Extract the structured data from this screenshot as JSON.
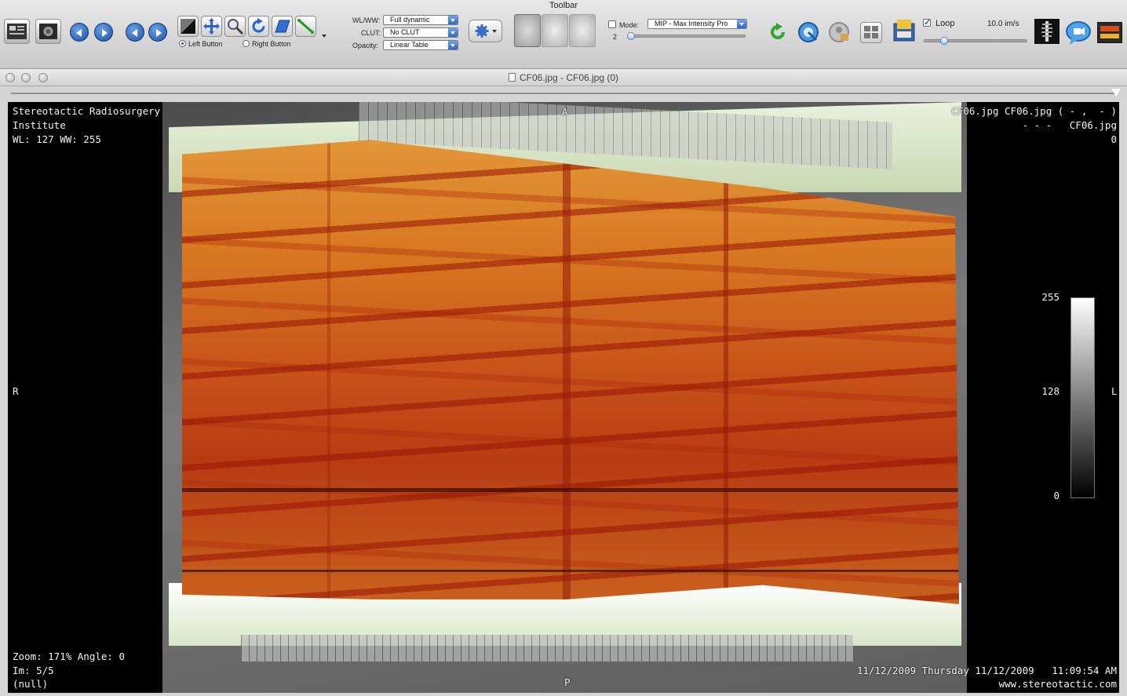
{
  "toolbar": {
    "title": "Toolbar",
    "left_button_label": "Left Button",
    "right_button_label": "Right Button",
    "wlww_label": "WL/WW:",
    "wlww_value": "Full dynamic",
    "clut_label": "CLUT:",
    "clut_value": "No CLUT",
    "opacity_label": "Opacity:",
    "opacity_value": "Linear Table",
    "mode_label": "Mode:",
    "mode_value": "MIP - Max Intensity Pro",
    "slab_value": "2",
    "loop_label": "Loop",
    "loop_checked": true,
    "speed_label": "10.0 im/s"
  },
  "window": {
    "title": "CF06.jpg - CF06.jpg (0)"
  },
  "overlay": {
    "top_left_line1": "Stereotactic Radiosurgery",
    "top_left_line2": "Institute",
    "top_left_line3": "WL: 127 WW: 255",
    "top_right_line1": "CF06.jpg CF06.jpg ( - ,  - )",
    "top_right_line2": "- - -   CF06.jpg",
    "top_right_line3": "0",
    "orient_top": "A",
    "orient_bottom": "P",
    "orient_left": "R",
    "orient_right": "L",
    "bottom_left_line1": "Zoom: 171% Angle: 0",
    "bottom_left_line2": "Im: 5/5",
    "bottom_left_line3": "(null)",
    "bottom_right_line1": "11/12/2009 Thursday 11/12/2009   11:09:54 AM",
    "bottom_right_line2": "www.stereotactic.com",
    "colorbar_max": "255",
    "colorbar_mid": "128",
    "colorbar_min": "0"
  },
  "icons": {
    "toolbar": [
      "database-icon",
      "viewer-icon",
      "previous-series-icon",
      "next-series-icon",
      "previous-image-icon",
      "next-image-icon",
      "wlww-tool-icon",
      "move-tool-icon",
      "zoom-tool-icon",
      "rotate-tool-icon",
      "slab-tool-icon",
      "measure-tool-icon",
      "settings-icon",
      "reset-icon",
      "sync-icon",
      "anonymize-icon",
      "layout-icon",
      "export-icon",
      "spine-icon",
      "chat-icon",
      "warning-icon"
    ]
  },
  "colors": {
    "tool_accent": "#1f5fd0",
    "reset_green": "#2ea82e",
    "viewer_background": "#000000",
    "overlay_text": "#f2f2f2"
  }
}
